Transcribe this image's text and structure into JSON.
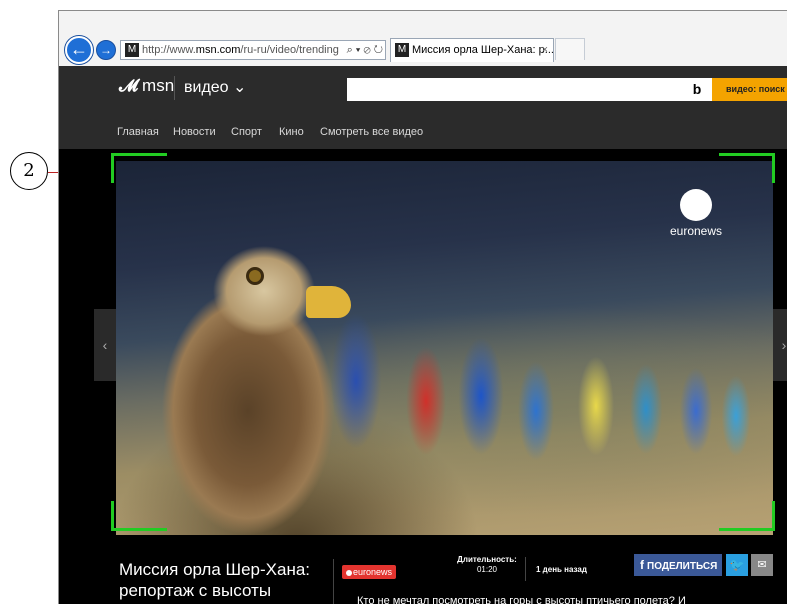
{
  "browser": {
    "back_glyph": "←",
    "forward_glyph": "→",
    "url_prefix": "http://www.",
    "url_host": "msn.com",
    "url_path": "/ru-ru/video/trending",
    "address_icons": "⌕ ▾ ⊘ ↻",
    "favicon_glyph": "M",
    "tab_title": "Миссия орла Шер-Хана: р...",
    "tab_close": "×"
  },
  "header": {
    "logo_mark": "𝓜",
    "logo_text": "msn",
    "section": "видео ⌄",
    "search_placeholder": "",
    "bing_mark": "b",
    "search_button": "видео: поиск"
  },
  "nav": {
    "items": [
      "Главная",
      "Новости",
      "Спорт",
      "Кино",
      "Смотреть все видео"
    ]
  },
  "video": {
    "watermark": "euronews",
    "prev_glyph": "‹",
    "next_glyph": "›"
  },
  "info": {
    "title": "Миссия орла Шер-Хана: репортаж с высоты",
    "source": "euronews",
    "duration_label": "Длительность:",
    "duration_value": "01:20",
    "age": "1 день назад",
    "share_icon": "f",
    "share_label": "ПОДЕЛИТЬСЯ",
    "twitter_icon": "🐦",
    "mail_icon": "✉",
    "description": "Кто не мечтал посмотреть на горы с высоты птичьего полета? И"
  },
  "annotation": {
    "callout_number": "2"
  },
  "colors": {
    "header_bg": "#2b2b2b",
    "search_button": "#f4a300",
    "frame_highlight": "#22cc22",
    "facebook": "#3b5998",
    "twitter": "#2a9fe0",
    "euronews_badge": "#e3342f"
  }
}
